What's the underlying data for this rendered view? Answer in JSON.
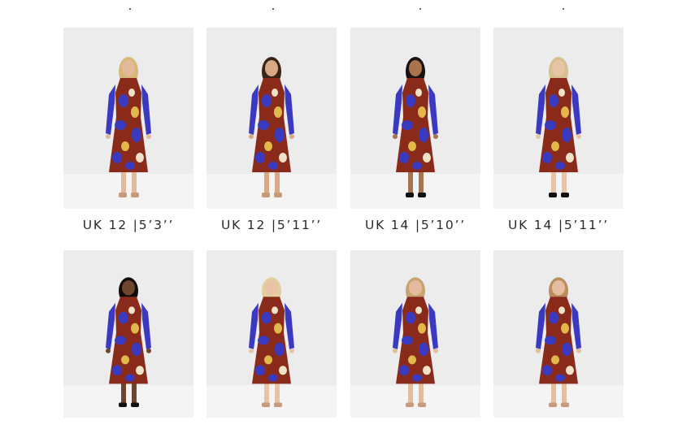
{
  "colors": {
    "card_bg": "#ececec",
    "dress_base": "#8a2a1a",
    "dress_blue": "#3a3ac0",
    "dress_yellow": "#e3b84a",
    "dress_cream": "#efe2c8"
  },
  "products": [
    {
      "size_label": "UK 12 |5’3’’",
      "hair": "#d8b67a",
      "skin": "#e2b999",
      "shoes": "nude"
    },
    {
      "size_label": "UK 12 |5’11’’",
      "hair": "#3a2418",
      "skin": "#d9a884",
      "shoes": "nude"
    },
    {
      "size_label": "UK 14 |5’10’’",
      "hair": "#1a120e",
      "skin": "#a8734f",
      "shoes": "black"
    },
    {
      "size_label": "UK 14 |5’11’’",
      "hair": "#d6c08f",
      "skin": "#e8c4a6",
      "shoes": "black"
    },
    {
      "size_label": "",
      "hair": "#120c0a",
      "skin": "#6e452e",
      "shoes": "black"
    },
    {
      "size_label": "",
      "hair": "#e2cfa0",
      "skin": "#e9c3a5",
      "shoes": "nude"
    },
    {
      "size_label": "",
      "hair": "#c9a473",
      "skin": "#e4bb9c",
      "shoes": "nude"
    },
    {
      "size_label": "",
      "hair": "#b98e5e",
      "skin": "#e6be9f",
      "shoes": "nude"
    }
  ]
}
